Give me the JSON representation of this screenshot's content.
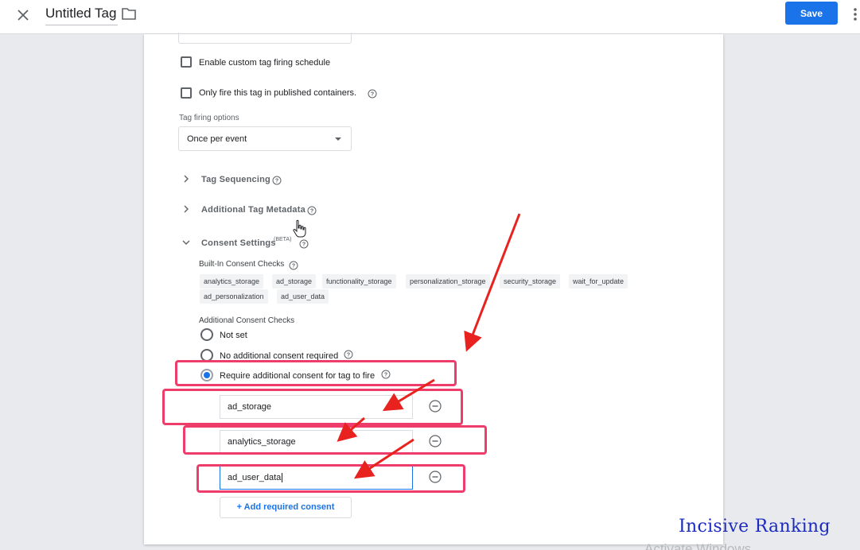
{
  "header": {
    "title": "Untitled Tag",
    "save_label": "Save"
  },
  "firing": {
    "custom_schedule_label": "Enable custom tag firing schedule",
    "published_only_label": "Only fire this tag in published containers.",
    "options_label": "Tag firing options",
    "options_value": "Once per event"
  },
  "sections": {
    "sequencing": "Tag Sequencing",
    "metadata": "Additional Tag Metadata",
    "consent": "Consent Settings",
    "consent_badge": "(BETA)"
  },
  "consent": {
    "builtin_label": "Built-In Consent Checks",
    "builtin_chips": [
      "analytics_storage",
      "ad_storage",
      "functionality_storage",
      "personalization_storage",
      "security_storage",
      "wait_for_update",
      "ad_personalization",
      "ad_user_data"
    ],
    "additional_label": "Additional Consent Checks",
    "options": [
      {
        "label": "Not set",
        "selected": false
      },
      {
        "label": "No additional consent required",
        "selected": false
      },
      {
        "label": "Require additional consent for tag to fire",
        "selected": true
      }
    ],
    "required": [
      "ad_storage",
      "analytics_storage",
      "ad_user_data"
    ],
    "add_label": "+ Add required consent"
  },
  "overlay": {
    "watermark": "Incisive Ranking",
    "activate": "Activate Windows",
    "highlight_color": "#ef3d6b",
    "arrow_color": "#e8231f"
  },
  "colors": {
    "accent": "#1a73e8",
    "background": "#e8eaed"
  }
}
